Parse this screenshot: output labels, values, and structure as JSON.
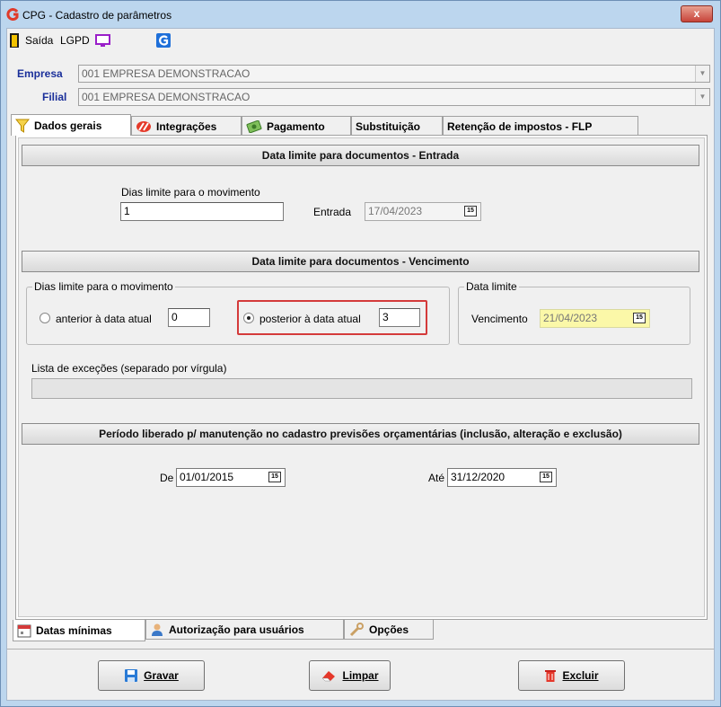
{
  "window": {
    "title": "CPG - Cadastro de parâmetros",
    "close_label": "x"
  },
  "toolbar": {
    "exit_label": "Saída",
    "lgpd_label": "LGPD"
  },
  "header": {
    "empresa_label": "Empresa",
    "empresa_value": "001 EMPRESA DEMONSTRACAO",
    "filial_label": "Filial",
    "filial_value": "001 EMPRESA DEMONSTRACAO"
  },
  "tabs": [
    {
      "label": "Dados gerais",
      "icon": "filter-icon",
      "active": true
    },
    {
      "label": "Integrações",
      "icon": "integration-icon",
      "active": false
    },
    {
      "label": "Pagamento",
      "icon": "money-icon",
      "active": false
    },
    {
      "label": "Substituição",
      "icon": "",
      "active": false
    },
    {
      "label": "Retenção de impostos - FLP",
      "icon": "",
      "active": false
    }
  ],
  "entrada_section": {
    "header": "Data limite para documentos - Entrada",
    "dias_label": "Dias limite para o movimento",
    "dias_value": "1",
    "entrada_label": "Entrada",
    "entrada_date": "17/04/2023"
  },
  "vencimento_section": {
    "header": "Data limite para documentos - Vencimento",
    "group_dias_label": "Dias limite para o movimento",
    "anterior_label": "anterior à data atual",
    "anterior_value": "0",
    "posterior_label": "posterior à data atual",
    "posterior_value": "3",
    "selected_option": "posterior",
    "group_data_label": "Data limite",
    "vencimento_label": "Vencimento",
    "vencimento_date": "21/04/2023",
    "excecoes_label": "Lista de exceções (separado por vírgula)",
    "excecoes_value": ""
  },
  "periodo_section": {
    "header": "Período liberado p/ manutenção no cadastro previsões orçamentárias (inclusão, alteração e exclusão)",
    "de_label": "De",
    "de_date": "01/01/2015",
    "ate_label": "Até",
    "ate_date": "31/12/2020"
  },
  "calendar_glyph": "15",
  "bottom_tabs": [
    {
      "label": "Datas mínimas",
      "icon": "calendar-icon",
      "active": true
    },
    {
      "label": "Autorização para usuários",
      "icon": "user-icon",
      "active": false
    },
    {
      "label": "Opções",
      "icon": "wrench-icon",
      "active": false
    }
  ],
  "buttons": {
    "save_label": "Gravar",
    "clear_label": "Limpar",
    "delete_label": "Excluir"
  },
  "colors": {
    "highlight_outline": "#d43a3a",
    "date_highlight_bg": "#fbf8a8",
    "brand_red": "#e03a2a",
    "label_blue": "#1a2f9a"
  }
}
